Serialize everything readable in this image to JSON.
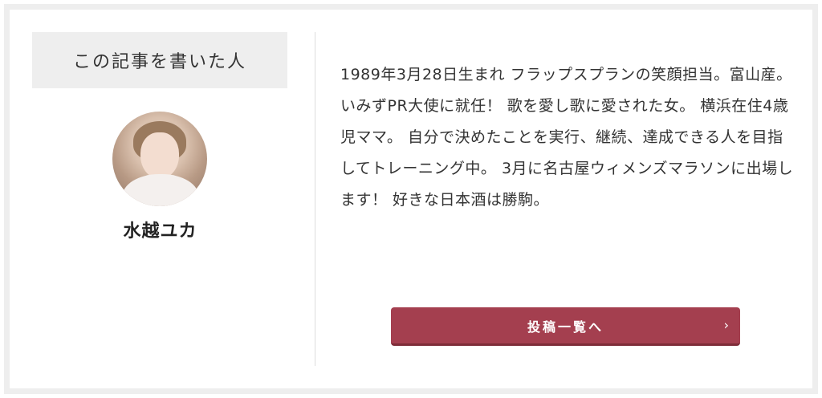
{
  "author_box": {
    "heading": "この記事を書いた人",
    "author_name": "水越ユカ",
    "bio": "1989年3月28日生まれ フラップスプランの笑顔担当。富山産。いみずPR大使に就任！ 歌を愛し歌に愛された女。 横浜在住4歳児ママ。 自分で決めたことを実行、継続、達成できる人を目指してトレーニング中。 3月に名古屋ウィメンズマラソンに出場します！ 好きな日本酒は勝駒。",
    "button_label": "投稿一覧へ",
    "button_icon": "chevron-right-icon"
  },
  "colors": {
    "button_bg": "#a43f4f",
    "heading_bg": "#eeeeee",
    "frame": "#eeeeee"
  }
}
